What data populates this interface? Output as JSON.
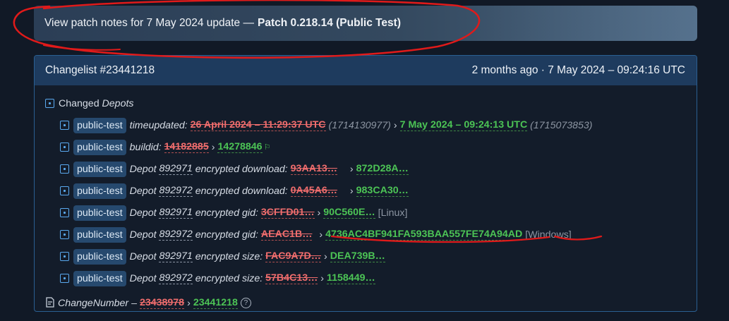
{
  "patch_banner": {
    "prefix": "View patch notes for 7 May 2024 update —",
    "title": "Patch 0.218.14 (Public Test)"
  },
  "changelist": {
    "title": "Changelist #23441218",
    "time": "2 months ago · 7 May 2024 – 09:24:16 UTC"
  },
  "changed_depots": {
    "prefix": "Changed",
    "label": "Depots"
  },
  "rows": [
    {
      "badge": "public-test",
      "label": "timeupdated:",
      "old": "26 April 2024 – 11:29:37 UTC",
      "old_raw": "(1714130977)",
      "new": "7 May 2024 – 09:24:13 UTC",
      "new_raw": "(1715073853)"
    },
    {
      "badge": "public-test",
      "label": "buildid:",
      "old": "14182885",
      "new": "14278846"
    },
    {
      "badge": "public-test",
      "label_pre": "Depot",
      "depot": "892971",
      "label_post": "encrypted download:",
      "old": "93AA13…",
      "new": "872D28A…"
    },
    {
      "badge": "public-test",
      "label_pre": "Depot",
      "depot": "892972",
      "label_post": "encrypted download:",
      "old": "0A45A6…",
      "new": "983CA30…"
    },
    {
      "badge": "public-test",
      "label_pre": "Depot",
      "depot": "892971",
      "label_post": "encrypted gid:",
      "old": "3CFFD01…",
      "new": "90C560E…",
      "platform": "[Linux]"
    },
    {
      "badge": "public-test",
      "label_pre": "Depot",
      "depot": "892972",
      "label_post": "encrypted gid:",
      "old": "AEAC1B…",
      "new": "4736AC4BF941FA593BAA557FE74A94AD",
      "platform": "[Windows]"
    },
    {
      "badge": "public-test",
      "label_pre": "Depot",
      "depot": "892971",
      "label_post": "encrypted size:",
      "old": "FAC9A7D…",
      "new": "DEA739B…"
    },
    {
      "badge": "public-test",
      "label_pre": "Depot",
      "depot": "892972",
      "label_post": "encrypted size:",
      "old": "57B4C13…",
      "new": "1158449…"
    }
  ],
  "change_number": {
    "label": "ChangeNumber –",
    "old": "23438978",
    "new": "23441218",
    "help": "?"
  },
  "arrow": "›",
  "colors": {
    "annotation": "#e01a1a",
    "added": "#4cc455",
    "removed": "#f06d6d"
  }
}
